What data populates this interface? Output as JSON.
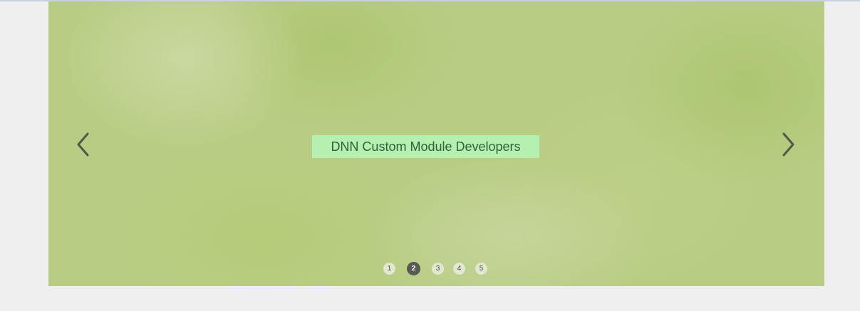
{
  "slider": {
    "caption": "DNN Custom Module Developers",
    "prev_icon": "chevron-left-icon",
    "next_icon": "chevron-right-icon",
    "pager": [
      "1",
      "2",
      "3",
      "4",
      "5"
    ],
    "active_page": "2"
  },
  "colors": {
    "page_background": "#efefef",
    "slide_green": "#b8cd84",
    "caption_background": "#b6f0b0",
    "caption_text": "#2f5f3b",
    "arrow": "#4d5a4a",
    "pager_active": "#565b53",
    "pager_inactive": "#e1e8cf"
  }
}
